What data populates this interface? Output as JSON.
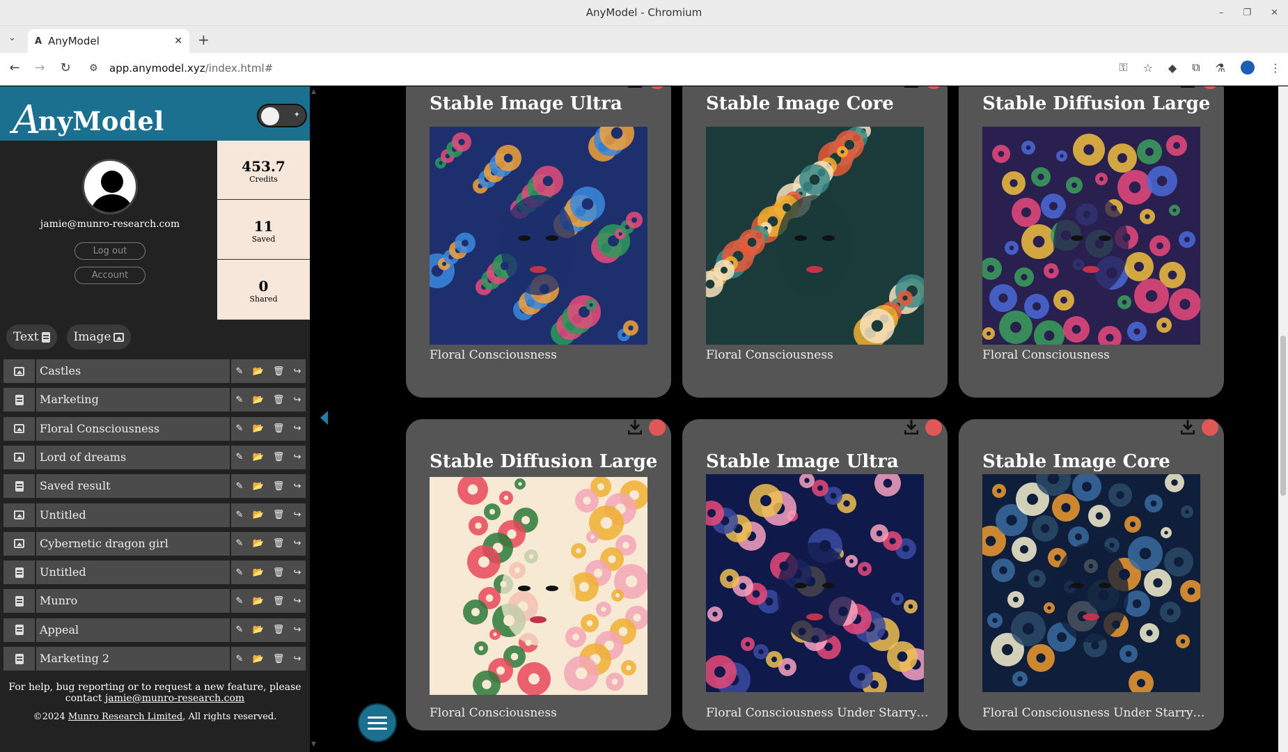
{
  "window": {
    "title": "AnyModel - Chromium"
  },
  "tab": {
    "title": "AnyModel"
  },
  "address": {
    "host": "app.anymodel.xyz",
    "path": "/index.html#"
  },
  "brand": {
    "logo_initial": "A",
    "logo_rest": "nyModel"
  },
  "user": {
    "email": "jamie@munro-research.com",
    "logout": "Log out",
    "account": "Account"
  },
  "stats": [
    {
      "value": "453.7",
      "label": "Credits"
    },
    {
      "value": "11",
      "label": "Saved"
    },
    {
      "value": "0",
      "label": "Shared"
    }
  ],
  "filters": {
    "text": "Text",
    "image": "Image"
  },
  "items": [
    {
      "label": "Castles",
      "type": "image"
    },
    {
      "label": "Marketing",
      "type": "text"
    },
    {
      "label": "Floral Consciousness",
      "type": "image"
    },
    {
      "label": "Lord of dreams",
      "type": "image"
    },
    {
      "label": "Saved result",
      "type": "text"
    },
    {
      "label": "Untitled",
      "type": "image"
    },
    {
      "label": "Cybernetic dragon girl",
      "type": "image"
    },
    {
      "label": "Untitled",
      "type": "text"
    },
    {
      "label": "Munro",
      "type": "text"
    },
    {
      "label": "Appeal",
      "type": "text"
    },
    {
      "label": "Marketing 2",
      "type": "text"
    }
  ],
  "help": {
    "text": "For help, bug reporting or to request a new feature, please contact",
    "email": "jamie@munro-research.com",
    "copyright_prefix": "©2024",
    "company": "Munro Research Limited",
    "copyright_suffix": ", All rights reserved."
  },
  "cards": [
    {
      "model": "Stable Image Ultra",
      "caption": "Floral Consciousness",
      "palette": [
        "#1e2f6e",
        "#f2a23a",
        "#e64b7a",
        "#3a8ae0",
        "#2c9a5a"
      ]
    },
    {
      "model": "Stable Image Core",
      "caption": "Floral Consciousness",
      "palette": [
        "#1b3a3a",
        "#f0b030",
        "#e85a3a",
        "#3a8a8a",
        "#f6e2c0"
      ]
    },
    {
      "model": "Stable Diffusion Large",
      "caption": "Floral Consciousness",
      "palette": [
        "#2a2050",
        "#e84a7a",
        "#4a6ad8",
        "#f0c040",
        "#3aa05a"
      ]
    },
    {
      "model": "Stable Diffusion Large",
      "caption": "Floral Consciousness",
      "palette": [
        "#f7e9d3",
        "#e8485a",
        "#f3a7b6",
        "#2a7a3a",
        "#f0b030"
      ]
    },
    {
      "model": "Stable Image Ultra",
      "caption": "Floral Consciousness Under Starry ...",
      "palette": [
        "#101a4a",
        "#f7a2c0",
        "#f0c050",
        "#3a4aa0",
        "#e84a7a"
      ]
    },
    {
      "model": "Stable Image Core",
      "caption": "Floral Consciousness Under Starry ...",
      "palette": [
        "#0f1e3a",
        "#f09a30",
        "#3a6aa0",
        "#f6f0d0",
        "#2a4a6a"
      ]
    }
  ]
}
